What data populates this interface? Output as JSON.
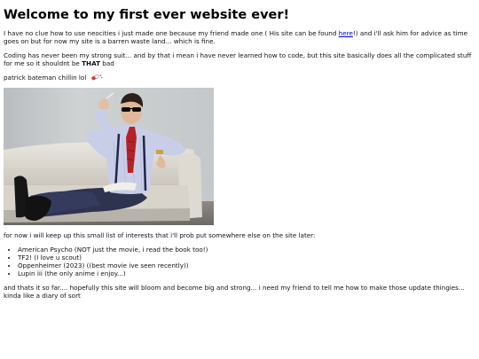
{
  "heading": "Welcome to my first ever website ever!",
  "intro": {
    "before_link": "I have no clue how to use neocities i just made one because my friend made one ( His site can be found ",
    "link_text": "here",
    "after_link": "!) and i'll ask him for advice as time goes on but for now my site is a barren waste land... which is fine."
  },
  "coding": {
    "before_bold": "Coding has never been my strong suit... and by that i mean i have never learned how to code, but this site basically does all the complicated stuff for me so it shouldnt be ",
    "bold": "THAT",
    "after_bold": " bad"
  },
  "caption": "patrick bateman chillin lol",
  "emoji_icon": "pill-emoji",
  "photo_icon": "patrick-bateman-photo",
  "interests_intro": "for now i will keep up this small list of interests that i'll prob put somewhere else on the site later:",
  "interests": [
    "American Psycho (NOT just the movie, i read the book too!)",
    "TF2! (I love u scout)",
    "Oppenheimer (2023) ((best movie ive seen recently))",
    "Lupin iii (the only anime i enjoy...)"
  ],
  "closing": "and thats it so far.... hopefully this site will bloom and become big and strong... i need my friend to tell me how to make those update thingies... kinda like a diary of sort",
  "colors": {
    "link": "#0000ee",
    "background": "#ffffff",
    "text": "#111111"
  }
}
